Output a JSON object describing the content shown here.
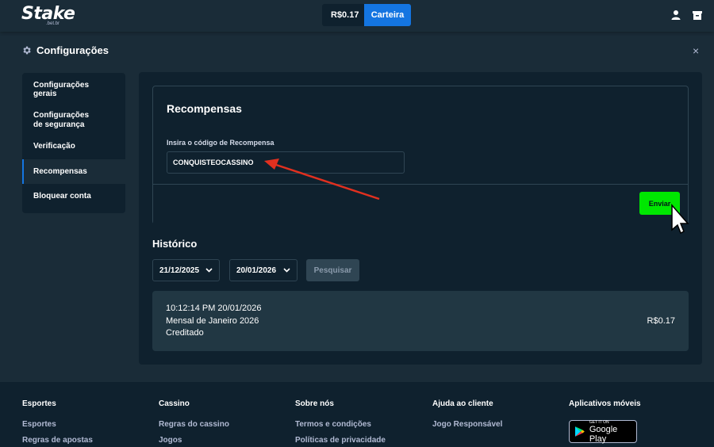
{
  "header": {
    "logo": "Stake",
    "logo_sub": ".bet.br",
    "balance": "R$0.17",
    "wallet_label": "Carteira",
    "icons": [
      "user-icon",
      "bag-icon"
    ]
  },
  "modal": {
    "title": "Configurações",
    "title_icon": "gear-icon",
    "close": "×"
  },
  "sidebar": {
    "items": [
      {
        "label": "Configurações gerais"
      },
      {
        "label": "Configurações de segurança"
      },
      {
        "label": "Verificação"
      },
      {
        "label": "Recompensas",
        "active": true
      },
      {
        "label": "Bloquear conta"
      }
    ]
  },
  "rewards": {
    "title": "Recompensas",
    "input_label": "Insira o código de Recompensa",
    "input_value": "CONQUISTEOCASSINO",
    "submit_label": "Enviar"
  },
  "history": {
    "title": "Histórico",
    "date_from": "21/12/2025",
    "date_to": "20/01/2026",
    "search_label": "Pesquisar",
    "entries": [
      {
        "timestamp": "10:12:14 PM 20/01/2026",
        "description": "Mensal de Janeiro 2026",
        "status": "Creditado",
        "amount": "R$0.17"
      }
    ]
  },
  "footer": {
    "columns": [
      {
        "heading": "Esportes",
        "links": [
          "Esportes",
          "Regras de apostas"
        ]
      },
      {
        "heading": "Cassino",
        "links": [
          "Regras do cassino",
          "Jogos"
        ]
      },
      {
        "heading": "Sobre nós",
        "links": [
          "Termos e condições",
          "Políticas de privacidade"
        ]
      },
      {
        "heading": "Ajuda ao cliente",
        "links": [
          "Jogo Responsável"
        ]
      },
      {
        "heading": "Aplicativos móveis",
        "links": []
      }
    ],
    "google_play_small": "GET IT ON",
    "google_play_big": "Google Play"
  },
  "colors": {
    "background": "#1a2c38",
    "panel": "#0f212e",
    "accent_blue": "#1475e1",
    "submit_green": "#00e701",
    "annotation_arrow": "#e1301f"
  }
}
